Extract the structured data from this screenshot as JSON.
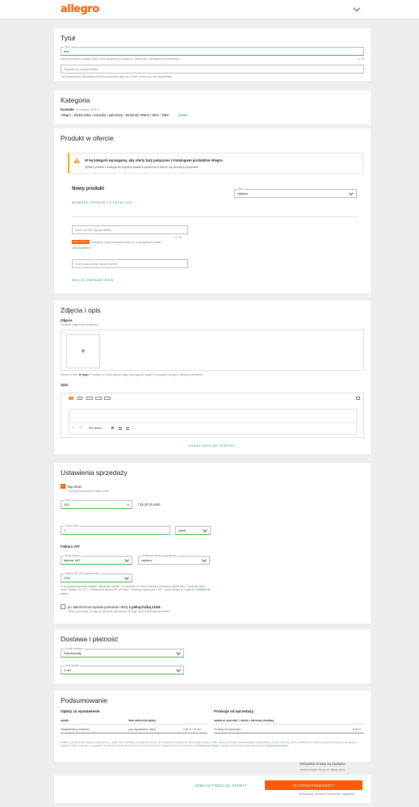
{
  "app": {
    "logo": "allegro"
  },
  "title_section": {
    "heading": "Tytuł",
    "title_label": "Tytuł",
    "title_value": "test",
    "title_hint": "Nazwa produktu, podając cechy, które pozwolą go rozpoznać. Więcej nie? wymagana jest parametry.",
    "title_counter": "4 / 75",
    "signature_placeholder": "Sygnatura (opcjonalnie)",
    "signature_hint": "Twój wewnętrzny identyfikator produktu widoczny tylko dla Ciebie. Możesz go nim wyszukiwać."
  },
  "category": {
    "heading": "Kategoria",
    "name": "Konsole",
    "id_text": "Nr kategorii 257373",
    "path": "Allegro › Elektronika › Konsole i automaty › Nintendo SNES i NES › NES",
    "change_link": "Zmień"
  },
  "product": {
    "heading": "Produkt w ofercie",
    "alert_title": "W tej kategorii wymagamy, aby oferty były połączone z Katalogiem produktów Allegro.",
    "alert_text": "Wybierz produkt z katalogu lub wypełnij dokładnie parametry w ofercie, aby stworzyć powiązanie.",
    "new_product": "Nowy produkt",
    "choose_catalog": "WYBIERZ PRODUKT Z KATALOGU",
    "state_label": "Stan",
    "state_value": "wybierz",
    "ean_placeholder": "EAN (GTIN) (opcjonalnie)",
    "ean_counter": "0 / 14",
    "badge": "Warto uzupełnić",
    "badge_text": "Kupujemy mogli promować oferty na, w specjalnych zleceń.",
    "how_link": "Jak uzupełnić?",
    "producer_code_placeholder": "Kod producenta (opcjonalnie)",
    "more_params": "WIĘCEJ PARAMETRÓW"
  },
  "photos": {
    "heading": "Zdjęcia i opis",
    "photos_label": "Zdjęcia",
    "photos_hint": "Pierwsze zdjęcie jest miniaturką.",
    "add_symbol": "+",
    "photos_note_a": "Możesz dodać ",
    "photos_note_b": "16 zdjęć",
    "photos_note_c": ". Pamiętaj, że dobre jakości zdjęć przyciąganie spójnie na podjęcie decyzji o zakupie przedmiotu.",
    "desc_label": "Opis",
    "text_style": "Styl tekstu",
    "add_row": "DODAJ KOLEJNY WIERSZ"
  },
  "sales": {
    "heading": "Ustawienia sprzedaży",
    "buy_now": "kup teraz",
    "buy_now_hint": "Sprzedaj przedmiot po stałej cenie",
    "price_label": "Cena",
    "price_value": "100",
    "price_currency": "zł",
    "price_net": "/ 81,30 zł netto",
    "qty_label": "Liczba sztuk",
    "qty_value": "1",
    "unit_value": "sztuk",
    "vat_heading": "Faktura VAT",
    "invoice_label": "Opcja faktury",
    "invoice_value": "faktura VAT",
    "subject_label": "Przedmiot oferty (opcjonalnie)",
    "subject_value": "wybierz",
    "rate_label": "Stawka VAT (PL) (opcjonalnie)",
    "rate_value": "23%",
    "vat_hint": "W przypadku transakcji objętych regulacjami pakietu eCommerce VAT kwot deklaracji traktowany będzie jako: Przedmiot oferty - towar, Stawka VAT (PL) - podstawowa stawka VAT w Polsce. Podstawa wyłączenia z VAT - brak podstaw do wyłączeń.",
    "vat_hint_link": "Dowiedz się więcej.",
    "relist_a": "po zakończeniu wystaw ponownie oferty ",
    "relist_b": "z pełną liczbą sztuk",
    "relist_hint": "Oferty wznowimy, ze stałą liczbą sztuk niezależnie od tego, ile przedmiotów sprzedasz."
  },
  "delivery": {
    "heading": "Dostawa i płatność",
    "price_list_label": "Cennik dostawy",
    "price_list_value": "Paczkomaty",
    "ship_time_label": "Czas wysyłki",
    "ship_time_value": "2 dni"
  },
  "summary": {
    "heading": "Podsumowanie",
    "fees_title": "Opłaty za wystawienie",
    "col_fee": "opłata",
    "col_date": "data naliczenia opłaty",
    "row_fee": "Wystawienie przedmiotu",
    "row_date": "przy wystawieniu oferty",
    "row_amount": "0,00 zł / 10 dni",
    "commission_title": "Prowizje od sprzedaży",
    "commission_col": "opłata za sprzedaż 1 sztuki z darmową dostawą",
    "commission_row": "Prowizja od sprzedaży",
    "commission_amount": "6,00 zł",
    "note_a": "Podane wysokość jest wyceną szacunkową - opłata się na aktualnej konfiguracji oferty i nie uwzględnia ustalonych opłat zaraportowanych dla oferty (jeżeli takie występowałyby kiedykolwiek). Kwota może się różnić od faktycznie wyliczonej kwoty, która jest podstawą do ustalenia opłaty należnej w przypadku sprzedaży przedmiotów. Pełny koszt opłat dla oferty zostanie doliczony do faktury w ",
    "note_link1": "Rozliczenia z Allegro",
    "note_b": ". Zasady wyznaczenia opłat opisane są w ",
    "note_link2": "Regulaminie Allegro",
    "note_c": "."
  },
  "footer": {
    "saved": "Wszystkie zmiany są zapisane",
    "saved_sub": "ostatnia edycja minęła mi minutę temu",
    "preview": "ZOBACZ PODGLĄD OFERTY",
    "publish": "WYSTAW PRZEDMIOT",
    "accept_a": "Wystawiając, przedmiot akceptujesz ",
    "accept_link": "regulamin",
    "accept_c": "."
  },
  "colors": {
    "accent": "#ff5a00",
    "link": "#2a8a80",
    "valid": "#4caf50",
    "warn": "#f5a623"
  }
}
